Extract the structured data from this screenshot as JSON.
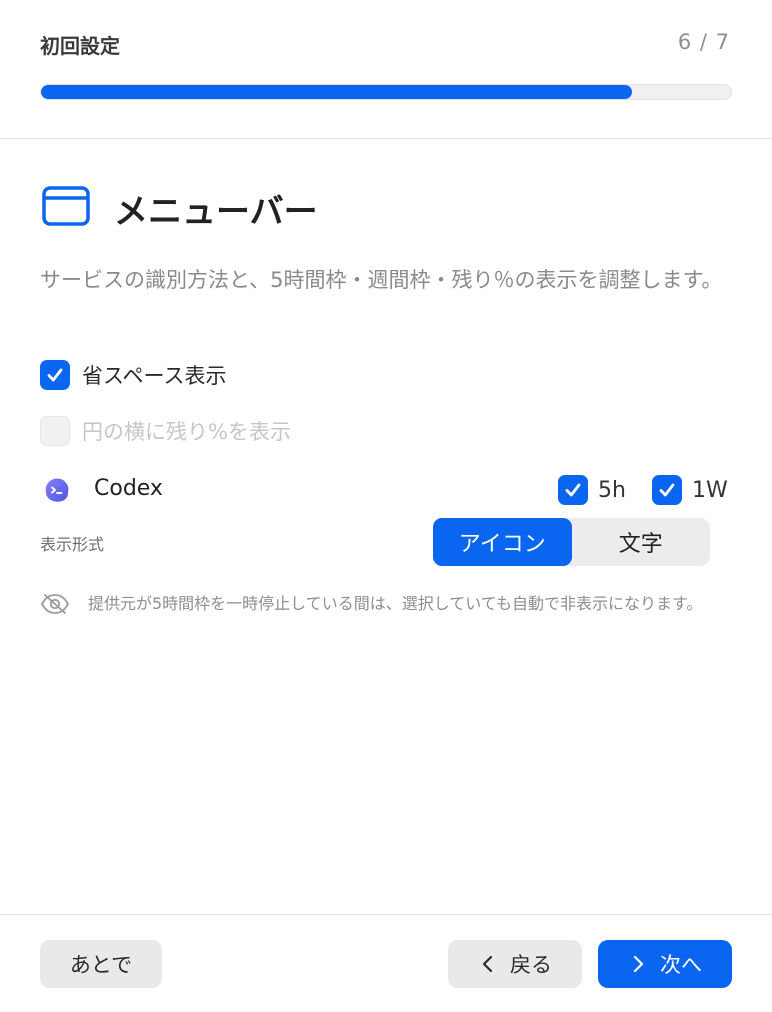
{
  "header": {
    "title": "初回設定",
    "step": "6 / 7",
    "progress": 0.857
  },
  "section": {
    "icon": "menubar-window-icon",
    "title": "メニューバー",
    "description": "サービスの識別方法と、5時間枠・週間枠・残り％の表示を調整します。"
  },
  "options": {
    "compact": {
      "label": "省スペース表示",
      "checked": true
    },
    "remaining_beside_circle": {
      "label": "円の横に残り%を表示",
      "checked": false,
      "disabled": true
    }
  },
  "service": {
    "name": "Codex",
    "icon": "codex-icon",
    "windows": [
      {
        "label": "5h",
        "checked": true
      },
      {
        "label": "1W",
        "checked": true
      }
    ]
  },
  "display_format": {
    "label": "表示形式",
    "options": [
      "アイコン",
      "文字"
    ],
    "selected": "アイコン"
  },
  "note": {
    "icon": "eye-slash-icon",
    "text": "提供元が5時間枠を一時停止している間は、選択していても自動で非表示になります。"
  },
  "footer": {
    "later": "あとで",
    "back": "戻る",
    "next": "次へ"
  },
  "colors": {
    "accent": "#0a66f0"
  }
}
